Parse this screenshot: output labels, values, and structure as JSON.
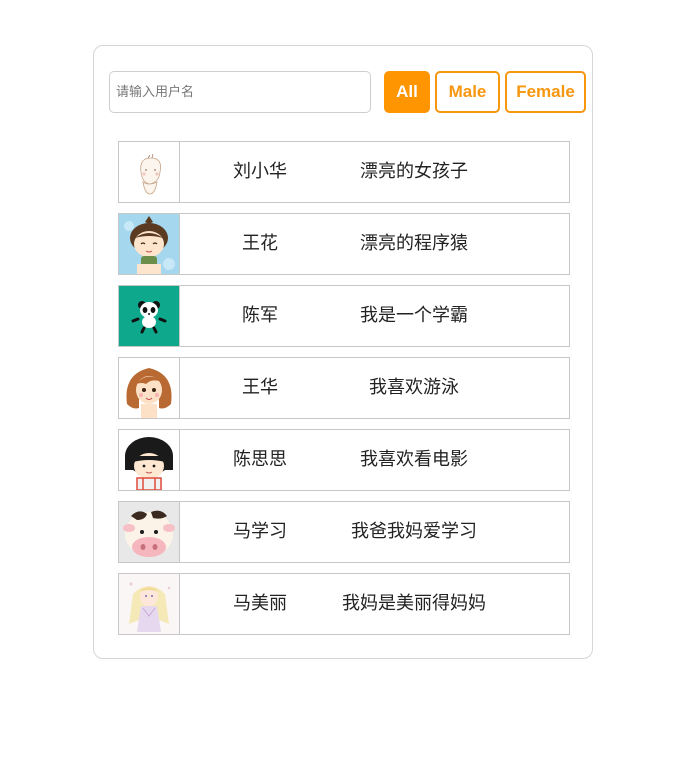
{
  "search": {
    "placeholder": "请输入用户名",
    "value": ""
  },
  "filters": [
    {
      "label": "All",
      "active": true
    },
    {
      "label": "Male",
      "active": false
    },
    {
      "label": "Female",
      "active": false
    }
  ],
  "users": [
    {
      "name": "刘小华",
      "desc": "漂亮的女孩子",
      "avatar": "sketch-girl-avatar"
    },
    {
      "name": "王花",
      "desc": "漂亮的程序猿",
      "avatar": "cartoon-girl-avatar"
    },
    {
      "name": "陈军",
      "desc": "我是一个学霸",
      "avatar": "panda-avatar"
    },
    {
      "name": "王华",
      "desc": "我喜欢游泳",
      "avatar": "brown-hair-girl-avatar"
    },
    {
      "name": "陈思思",
      "desc": "我喜欢看电影",
      "avatar": "black-hair-girl-avatar"
    },
    {
      "name": "马学习",
      "desc": "我爸我妈爱学习",
      "avatar": "cow-avatar"
    },
    {
      "name": "马美丽",
      "desc": "我妈是美丽得妈妈",
      "avatar": "anime-girl-avatar"
    }
  ],
  "colors": {
    "accent": "#ff9500",
    "border": "#c7c7c7"
  }
}
